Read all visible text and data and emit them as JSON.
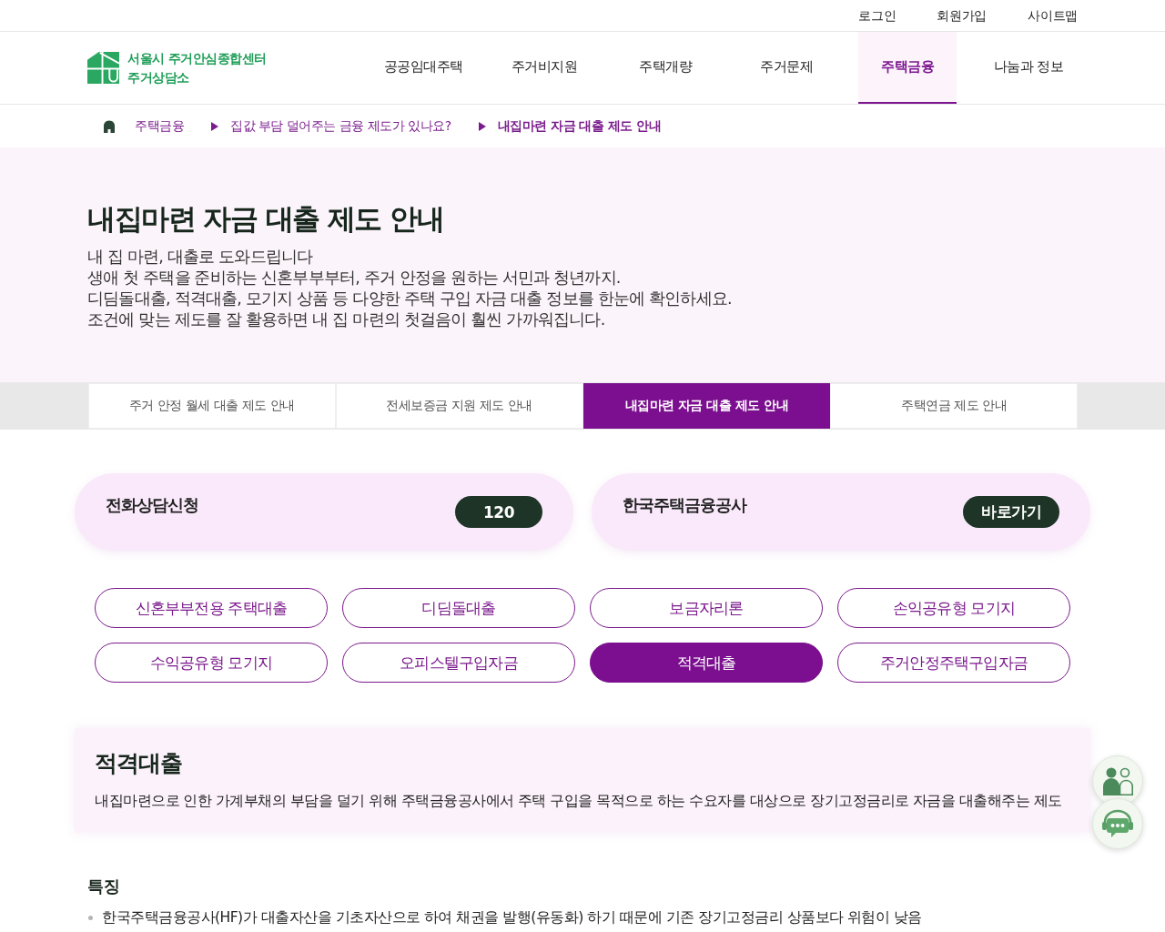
{
  "utility_links": [
    "로그인",
    "회원가입",
    "사이트맵"
  ],
  "logo": {
    "title": "서울시 주거안심종합센터",
    "subtitle": "주거상담소"
  },
  "nav": [
    {
      "label": "공공임대주택",
      "selected": false
    },
    {
      "label": "주거비지원",
      "selected": false
    },
    {
      "label": "주택개량",
      "selected": false
    },
    {
      "label": "주거문제",
      "selected": false
    },
    {
      "label": "주택금융",
      "selected": true
    },
    {
      "label": "나눔과 정보",
      "selected": false
    }
  ],
  "breadcrumb": [
    {
      "label": "주택금융",
      "current": false
    },
    {
      "label": "집값 부담 덜어주는 금융 제도가 있나요?",
      "current": false
    },
    {
      "label": "내집마련 자금 대출 제도 안내",
      "current": true
    }
  ],
  "hero": {
    "title": "내집마련 자금 대출 제도 안내",
    "lines": [
      "내 집 마련, 대출로 도와드립니다",
      "생애 첫 주택을 준비하는 신혼부부부터, 주거 안정을 원하는 서민과 청년까지.",
      "디딤돌대출, 적격대출, 모기지 상품 등 다양한 주택 구입 자금 대출 정보를 한눈에 확인하세요.",
      "조건에 맞는 제도를 잘 활용하면 내 집 마련의 첫걸음이 훨씬 가까워집니다."
    ]
  },
  "tabs": [
    {
      "label": "주거 안정 월세 대출 제도 안내",
      "selected": false
    },
    {
      "label": "전세보증금 지원 제도 안내",
      "selected": false
    },
    {
      "label": "내집마련 자금 대출 제도 안내",
      "selected": true
    },
    {
      "label": "주택연금 제도 안내",
      "selected": false
    }
  ],
  "contact_cards": [
    {
      "title": "전화상담신청",
      "action": "120"
    },
    {
      "title": "한국주택금융공사",
      "action": "바로가기"
    }
  ],
  "loan_types": [
    {
      "label": "신혼부부전용 주택대출",
      "selected": false
    },
    {
      "label": "디딤돌대출",
      "selected": false
    },
    {
      "label": "보금자리론",
      "selected": false
    },
    {
      "label": "손익공유형 모기지",
      "selected": false
    },
    {
      "label": "수익공유형 모기지",
      "selected": false
    },
    {
      "label": "오피스텔구입자금",
      "selected": false
    },
    {
      "label": "적격대출",
      "selected": true
    },
    {
      "label": "주거안정주택구입자금",
      "selected": false
    }
  ],
  "detail": {
    "title": "적격대출",
    "description": "내집마련으로 인한 가계부채의 부담을 덜기 위해 주택금융공사에서 주택 구입을 목적으로 하는 수요자를 대상으로 장기고정금리로 자금을 대출해주는 제도"
  },
  "features": {
    "heading": "특징",
    "items": [
      "한국주택금융공사(HF)가 대출자산을 기초자산으로 하여 채권을 발행(유동화) 하기 때문에 기존 장기고정금리 상품보다 위험이 낮음"
    ]
  }
}
